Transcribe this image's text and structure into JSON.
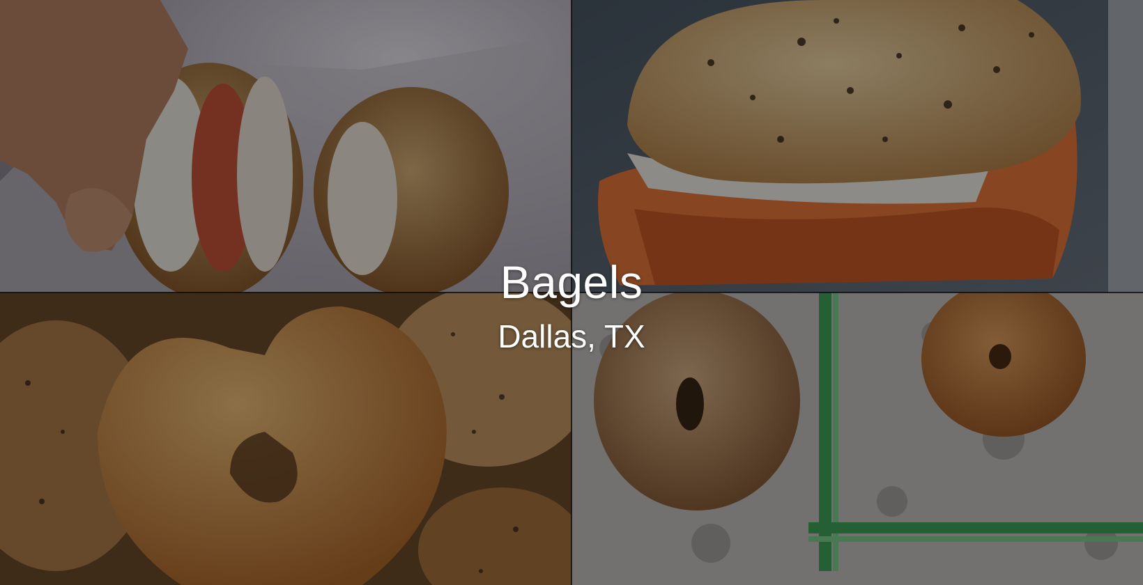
{
  "hero": {
    "title": "Bagels",
    "location": "Dallas, TX"
  },
  "photos": [
    {
      "name": "photo-bagel-sandwiches-in-paper"
    },
    {
      "name": "photo-everything-bagel-lox-closeup"
    },
    {
      "name": "photo-heart-shaped-bagel"
    },
    {
      "name": "photo-bagels-on-plastic-bags"
    }
  ],
  "colors": {
    "overlay": "rgba(0,0,0,0.42)",
    "text": "#ffffff"
  }
}
